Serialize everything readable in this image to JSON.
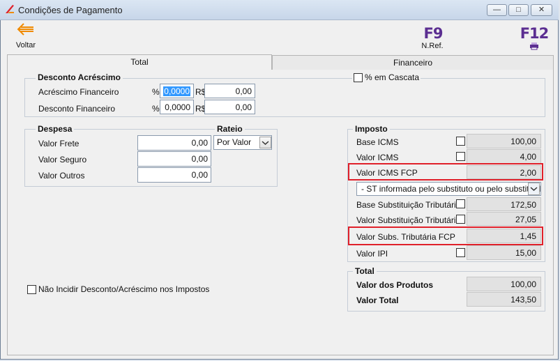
{
  "window": {
    "title": "Condições de Pagamento"
  },
  "toolbar": {
    "back_label": "Voltar",
    "f9_key": "F9",
    "f9_label": "N.Ref.",
    "f12_key": "F12"
  },
  "tabs": [
    {
      "label": "Total"
    },
    {
      "label": "Financeiro"
    }
  ],
  "desconto": {
    "title": "Desconto Acréscimo",
    "cascata_label": "% em Cascata",
    "rows": [
      {
        "label": "Acréscimo Financeiro",
        "pct_symbol": "%",
        "pct": "0,0000",
        "cur_symbol": "R$",
        "value": "0,00"
      },
      {
        "label": "Desconto Financeiro",
        "pct_symbol": "%",
        "pct": "0,0000",
        "cur_symbol": "R$",
        "value": "0,00"
      }
    ]
  },
  "despesa": {
    "title": "Despesa",
    "rateio_title": "Rateio",
    "rateio_value": "Por Valor",
    "rows": [
      {
        "label": "Valor Frete",
        "value": "0,00"
      },
      {
        "label": "Valor Seguro",
        "value": "0,00"
      },
      {
        "label": "Valor Outros",
        "value": "0,00"
      }
    ]
  },
  "nao_incidir_label": "Não Incidir Desconto/Acréscimo nos Impostos",
  "imposto": {
    "title": "Imposto",
    "base_icms": {
      "label": "Base ICMS",
      "value": "100,00"
    },
    "valor_icms": {
      "label": "Valor ICMS",
      "value": "4,00"
    },
    "icms_fcp": {
      "label": "Valor ICMS FCP",
      "value": "2,00"
    },
    "st_select": "- ST informada pelo substituto ou pelo substituído",
    "base_st": {
      "label": "Base Substituição Tributária",
      "value": "172,50"
    },
    "valor_st": {
      "label": "Valor Substituição Tributária",
      "value": "27,05"
    },
    "subs_fcp": {
      "label": "Valor Subs. Tributária FCP",
      "value": "1,45"
    },
    "ipi": {
      "label": "Valor IPI",
      "value": "15,00"
    }
  },
  "total": {
    "title": "Total",
    "produtos": {
      "label": "Valor dos Produtos",
      "value": "100,00"
    },
    "total": {
      "label": "Valor Total",
      "value": "143,50"
    }
  },
  "colors": {
    "accent_red": "#e0202a",
    "fkey_purple": "#5b2e91",
    "back_arrow": "#f08a00"
  }
}
